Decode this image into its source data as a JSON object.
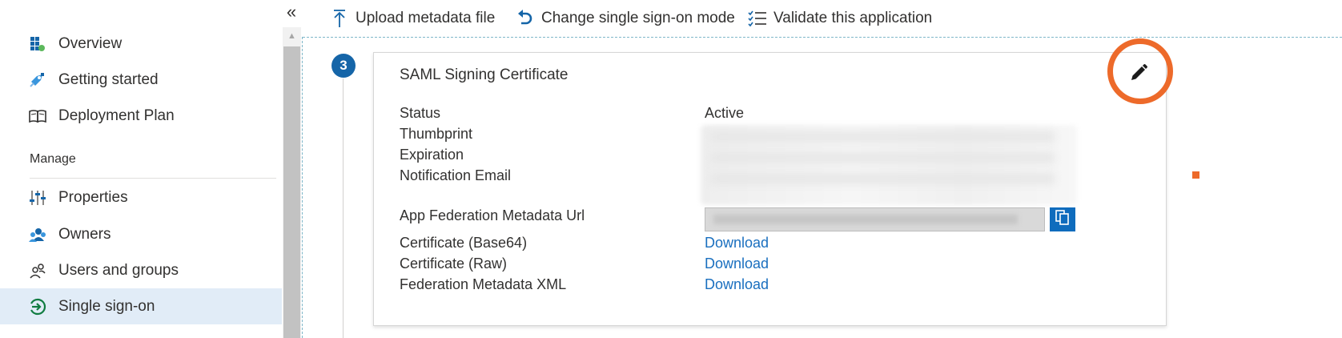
{
  "sidebar": {
    "collapse_glyph": "«",
    "items_top": [
      {
        "label": "Overview",
        "icon": "grid-overview-icon"
      },
      {
        "label": "Getting started",
        "icon": "rocket-icon"
      },
      {
        "label": "Deployment Plan",
        "icon": "book-icon"
      }
    ],
    "section_header": "Manage",
    "items_manage": [
      {
        "label": "Properties",
        "icon": "properties-sliders-icon"
      },
      {
        "label": "Owners",
        "icon": "owners-icon"
      },
      {
        "label": "Users and groups",
        "icon": "users-icon"
      },
      {
        "label": "Single sign-on",
        "icon": "sign-in-arrow-icon",
        "selected": true
      }
    ]
  },
  "toolbar": {
    "upload_label": "Upload metadata file",
    "change_label": "Change single sign-on mode",
    "validate_label": "Validate this application"
  },
  "step": {
    "number": "3"
  },
  "card": {
    "title": "SAML Signing Certificate",
    "fields": {
      "status_label": "Status",
      "status_value": "Active",
      "thumbprint_label": "Thumbprint",
      "expiration_label": "Expiration",
      "notification_label": "Notification Email",
      "metadata_url_label": "App Federation Metadata Url",
      "cert_base64_label": "Certificate (Base64)",
      "cert_raw_label": "Certificate (Raw)",
      "fed_xml_label": "Federation Metadata XML",
      "download_label": "Download"
    }
  },
  "colors": {
    "accent": "#0f6cbd",
    "link": "#1a6fbf",
    "highlight": "#ed6a2a",
    "selected_bg": "#e1ecf7"
  }
}
